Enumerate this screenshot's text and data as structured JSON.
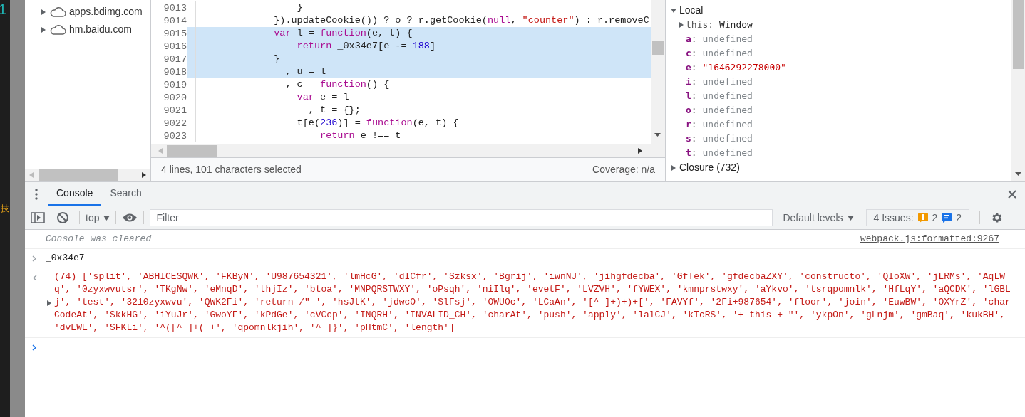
{
  "edge": {
    "top_char": "1",
    "mid_char": "技"
  },
  "file_tree": [
    {
      "label": "apps.bdimg.com",
      "expanded": false
    },
    {
      "label": "hm.baidu.com",
      "expanded": false
    }
  ],
  "editor": {
    "lines": [
      {
        "number": "9013",
        "selected": false,
        "tokens": [
          {
            "kind": "plain",
            "t": "                }"
          }
        ]
      },
      {
        "number": "9014",
        "selected": false,
        "tokens": [
          {
            "kind": "plain",
            "t": "            }).updateCookie()) ? o ? r.getCookie("
          },
          {
            "kind": "keyword",
            "t": "null"
          },
          {
            "kind": "plain",
            "t": ", "
          },
          {
            "kind": "string",
            "t": "\"counter\""
          },
          {
            "kind": "plain",
            "t": ") : r.removeC"
          }
        ]
      },
      {
        "number": "9015",
        "selected": true,
        "tokens": [
          {
            "kind": "keyword",
            "t": "            var"
          },
          {
            "kind": "plain",
            "t": " l = "
          },
          {
            "kind": "keyword",
            "t": "function"
          },
          {
            "kind": "plain",
            "t": "(e, t) {"
          }
        ]
      },
      {
        "number": "9016",
        "selected": true,
        "tokens": [
          {
            "kind": "keyword",
            "t": "                return"
          },
          {
            "kind": "plain",
            "t": " _0x34e7[e -= "
          },
          {
            "kind": "number",
            "t": "188"
          },
          {
            "kind": "plain",
            "t": "]"
          }
        ]
      },
      {
        "number": "9017",
        "selected": true,
        "tokens": [
          {
            "kind": "plain",
            "t": "            }"
          }
        ]
      },
      {
        "number": "9018",
        "selected": true,
        "tokens": [
          {
            "kind": "plain",
            "t": "              , u = l"
          }
        ]
      },
      {
        "number": "9019",
        "selected": false,
        "tokens": [
          {
            "kind": "plain",
            "t": "              , c = "
          },
          {
            "kind": "keyword",
            "t": "function"
          },
          {
            "kind": "plain",
            "t": "() {"
          }
        ]
      },
      {
        "number": "9020",
        "selected": false,
        "tokens": [
          {
            "kind": "keyword",
            "t": "                var"
          },
          {
            "kind": "plain",
            "t": " e = l"
          }
        ]
      },
      {
        "number": "9021",
        "selected": false,
        "tokens": [
          {
            "kind": "plain",
            "t": "                  , t = {};"
          }
        ]
      },
      {
        "number": "9022",
        "selected": false,
        "tokens": [
          {
            "kind": "plain",
            "t": "                t[e("
          },
          {
            "kind": "number",
            "t": "236"
          },
          {
            "kind": "plain",
            "t": ")] = "
          },
          {
            "kind": "keyword",
            "t": "function"
          },
          {
            "kind": "plain",
            "t": "(e, t) {"
          }
        ]
      },
      {
        "number": "9023",
        "selected": false,
        "tokens": [
          {
            "kind": "keyword",
            "t": "                    return"
          },
          {
            "kind": "plain",
            "t": " e !== t"
          }
        ]
      }
    ],
    "status": "4 lines, 101 characters selected",
    "coverage": "Coverage: n/a"
  },
  "scope": {
    "sections": [
      {
        "label": "Local",
        "expanded": true,
        "items": [
          {
            "kind": "object",
            "name": "this:",
            "value": "Window"
          },
          {
            "kind": "undefined",
            "name": "a:",
            "value": "undefined"
          },
          {
            "kind": "undefined",
            "name": "c:",
            "value": "undefined"
          },
          {
            "kind": "string",
            "name": "e:",
            "value": "\"1646292278000\""
          },
          {
            "kind": "undefined",
            "name": "i:",
            "value": "undefined"
          },
          {
            "kind": "undefined",
            "name": "l:",
            "value": "undefined"
          },
          {
            "kind": "undefined",
            "name": "o:",
            "value": "undefined"
          },
          {
            "kind": "undefined",
            "name": "r:",
            "value": "undefined"
          },
          {
            "kind": "undefined",
            "name": "s:",
            "value": "undefined"
          },
          {
            "kind": "undefined",
            "name": "t:",
            "value": "undefined"
          }
        ]
      },
      {
        "label": "Closure (732)",
        "expanded": false
      }
    ]
  },
  "drawer_tabs": [
    {
      "label": "Console",
      "selected": true
    },
    {
      "label": "Search",
      "selected": false
    }
  ],
  "toolbar": {
    "context": "top",
    "filter_placeholder": "Filter",
    "levels": "Default levels",
    "issues": {
      "label": "4 Issues:",
      "warnings": "2",
      "infos": "2"
    }
  },
  "console": {
    "messages": [
      {
        "kind": "info",
        "text": "Console was cleared",
        "source": "webpack.js:formatted:9267"
      },
      {
        "kind": "input",
        "text": "_0x34e7"
      },
      {
        "kind": "result",
        "text": "(74) ['split', 'ABHICESQWK', 'FKByN', 'U987654321', 'lmHcG', 'dICfr', 'Szksx', 'Bgrij', 'iwnNJ', 'jihgfdecba', 'GfTek', 'gfdecbaZXY', 'constructo', 'QIoXW', 'jLRMs', 'AqLWq', '0zyxwvutsr', 'TKgNw', 'eMnqD', 'thjIz', 'btoa', 'MNPQRSTWXY', 'oPsqh', 'niIlq', 'evetF', 'LVZVH', 'fYWEX', 'kmnprstwxy', 'aYkvo', 'tsrqpomnlk', 'HfLqY', 'aQCDK', 'lGBLj', 'test', '3210zyxwvu', 'QWK2Fi', 'return /\" ', 'hsJtK', 'jdwcO', 'SlFsj', 'OWUOc', 'LCaAn', '[^ ]+)+)+[', 'FAVYf', '2Fi+987654', 'floor', 'join', 'EuwBW', 'OXYrZ', 'charCodeAt', 'SkkHG', 'iYuJr', 'GwoYF', 'kPdGe', 'cVCcp', 'INQRH', 'INVALID_CH', 'charAt', 'push', 'apply', 'lalCJ', 'kTcRS', '+ this + \"', 'ykpOn', 'gLnjm', 'gmBaq', 'kukBH', 'dvEWE', 'SFKLi', '^([^ ]+( +', 'qpomnlkjih', '^ ]}', 'pHtmC', 'length']"
      },
      {
        "kind": "prompt"
      }
    ]
  }
}
